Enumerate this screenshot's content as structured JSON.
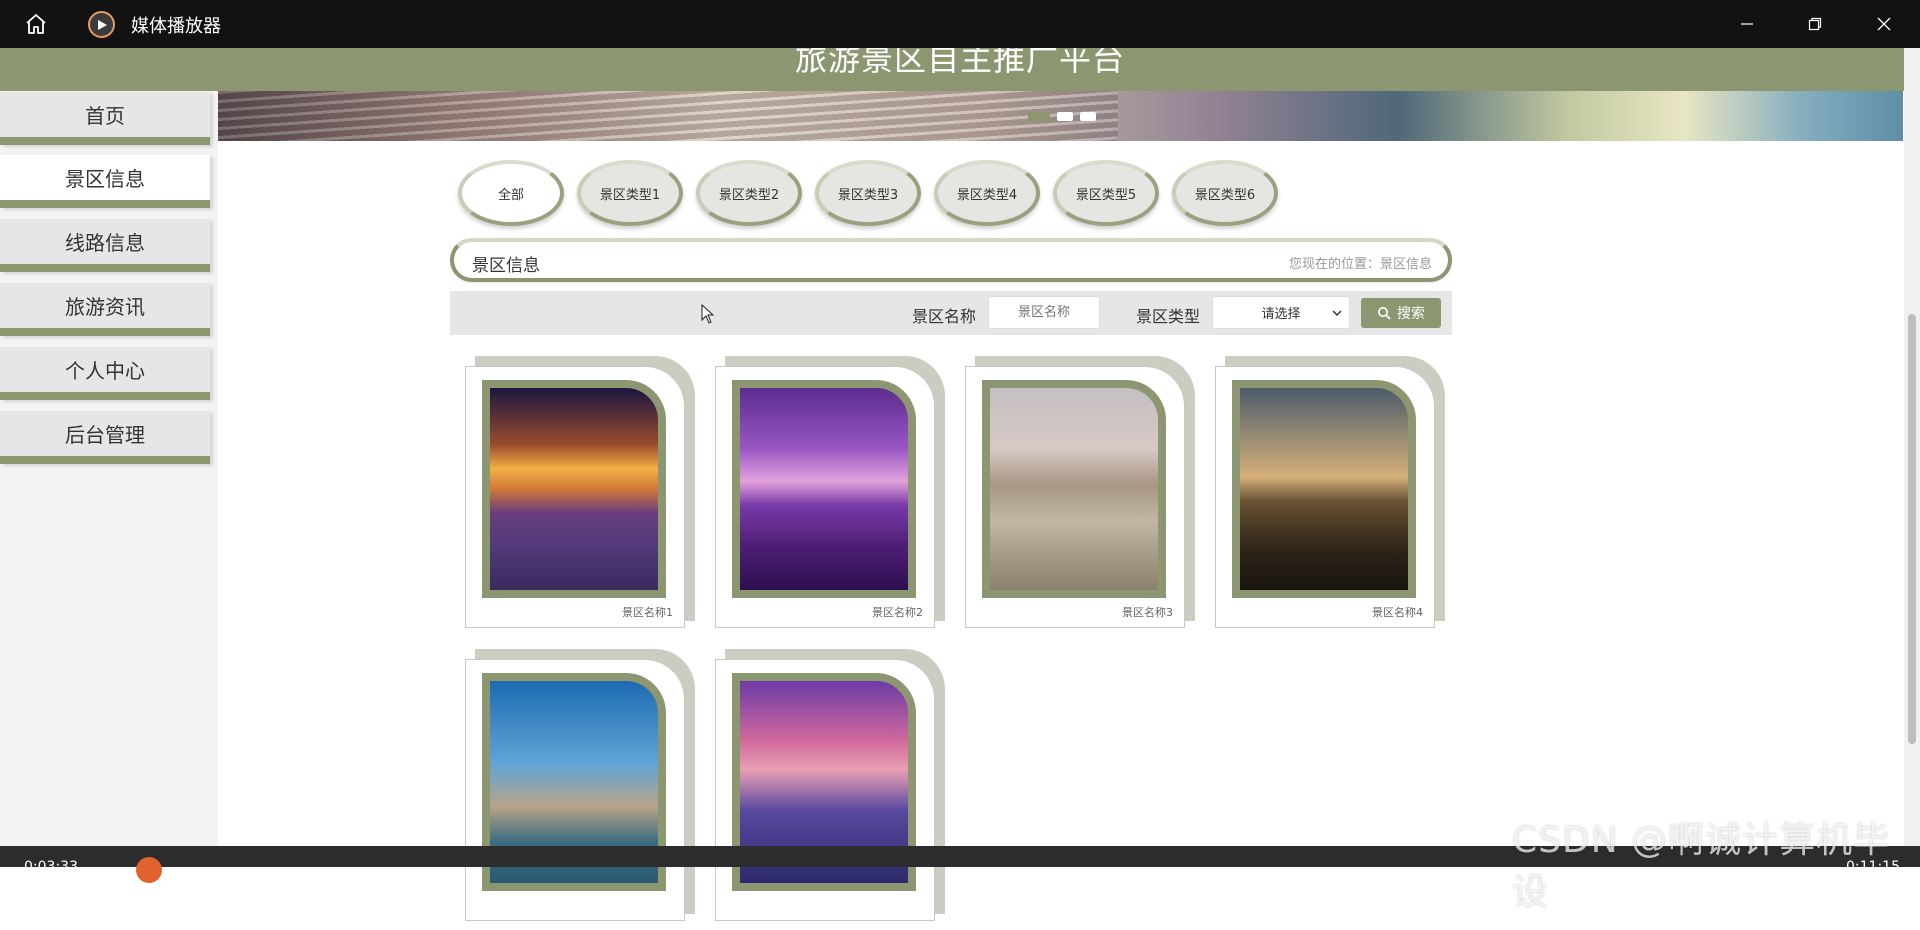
{
  "window": {
    "app_title": "媒体播放器",
    "icons": [
      "home-icon",
      "media-player-logo-icon",
      "minimize-icon",
      "restore-icon",
      "close-icon"
    ]
  },
  "site": {
    "title": "旅游景区自主推广平台"
  },
  "carousel": {
    "slides": 3,
    "active_index": 0
  },
  "sidebar": {
    "items": [
      {
        "label": "首页"
      },
      {
        "label": "景区信息"
      },
      {
        "label": "线路信息"
      },
      {
        "label": "旅游资讯"
      },
      {
        "label": "个人中心"
      },
      {
        "label": "后台管理"
      }
    ],
    "active": "景区信息"
  },
  "filters": {
    "items": [
      {
        "label": "全部"
      },
      {
        "label": "景区类型1"
      },
      {
        "label": "景区类型2"
      },
      {
        "label": "景区类型3"
      },
      {
        "label": "景区类型4"
      },
      {
        "label": "景区类型5"
      },
      {
        "label": "景区类型6"
      }
    ],
    "active": "全部"
  },
  "crumb": {
    "title": "景区信息",
    "location": "您现在的位置：景区信息"
  },
  "search": {
    "name_label": "景区名称",
    "name_placeholder": "景区名称",
    "type_label": "景区类型",
    "type_selected": "请选择",
    "button_label": "搜索"
  },
  "cards": [
    {
      "name": "景区名称1"
    },
    {
      "name": "景区名称2"
    },
    {
      "name": "景区名称3"
    },
    {
      "name": "景区名称4"
    },
    {
      "name": ""
    },
    {
      "name": ""
    }
  ],
  "watermark": "CSDN @啊诚计算机毕设",
  "player": {
    "elapsed": "0:03:33",
    "total": "0:11:15"
  },
  "colors": {
    "accent": "#8c9670",
    "titlebar": "#121212",
    "scrubber": "#e2622d"
  }
}
